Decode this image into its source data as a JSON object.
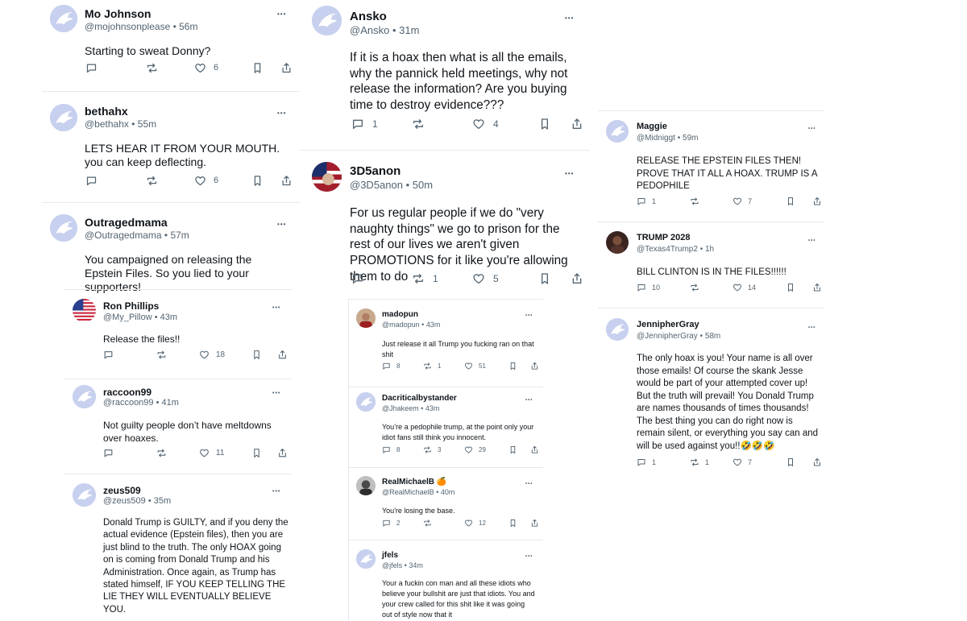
{
  "col1": [
    {
      "name": "Mo Johnson",
      "handle": "@mojohnsonplease",
      "time": "56m",
      "text": "Starting to sweat Donny?",
      "replies": "",
      "reposts": "",
      "likes": "6"
    },
    {
      "name": "bethahx",
      "handle": "@bethahx",
      "time": "55m",
      "text": "LETS HEAR IT FROM YOUR MOUTH.\nyou can keep deflecting.",
      "replies": "",
      "reposts": "",
      "likes": "6"
    },
    {
      "name": "Outragedmama",
      "handle": "@Outragedmama",
      "time": "57m",
      "text": "You campaigned on releasing the Epstein Files. So you lied to your supporters!",
      "replies": "",
      "reposts": "",
      "likes": ""
    },
    {
      "name": "Ron Phillips",
      "handle": "@My_Pillow",
      "time": "43m",
      "text": "Release the files!!",
      "replies": "",
      "reposts": "",
      "likes": "18"
    },
    {
      "name": "raccoon99",
      "handle": "@raccoon99",
      "time": "41m",
      "text": "Not guilty people don’t have meltdowns over hoaxes.",
      "replies": "",
      "reposts": "",
      "likes": "11"
    },
    {
      "name": "zeus509",
      "handle": "@zeus509",
      "time": "35m",
      "text": "Donald Trump is GUILTY, and if you deny the actual evidence (Epstein files), then you are just blind to the truth. The only HOAX going on is coming from Donald Trump and his Administration. Once again, as Trump has stated himself, IF YOU KEEP TELLING THE LIE THEY WILL EVENTUALLY BELIEVE YOU.",
      "replies": "",
      "reposts": "",
      "likes": ""
    }
  ],
  "col2": [
    {
      "name": "Ansko",
      "handle": "@Ansko",
      "time": "31m",
      "text": "If it is a hoax then what is all the emails, why the pannick held meetings, why not release the information? Are you buying time to destroy evidence???",
      "replies": "1",
      "reposts": "",
      "likes": "4"
    },
    {
      "name": "3D5anon",
      "handle": "@3D5anon",
      "time": "50m",
      "text": "For us regular people if we do \"very naughty things\" we go to prison for the rest of our lives we aren't given PROMOTIONS for it like you're allowing them to do",
      "replies": "",
      "reposts": "1",
      "likes": "5"
    },
    {
      "name": "madopun",
      "handle": "@madopun",
      "time": "43m",
      "text": "Just release it all Trump you fucking ran on that shit",
      "replies": "8",
      "reposts": "1",
      "likes": "51"
    },
    {
      "name": "Dacriticalbystander",
      "handle": "@Jhakeem",
      "time": "43m",
      "text": "You’re a pedophile trump, at the point only your idiot fans still think you innocent.",
      "replies": "8",
      "reposts": "3",
      "likes": "29"
    },
    {
      "name": "RealMichaelB 🍊",
      "handle": "@RealMichaelB",
      "time": "40m",
      "text": "You're losing the base.",
      "replies": "2",
      "reposts": "",
      "likes": "12"
    },
    {
      "name": "jfels",
      "handle": "@jfels",
      "time": "34m",
      "text": "Your a fuckin con man and all these idiots who believe your bullshit are just that idiots. You and your crew called for this shit like it was going out of style now that it",
      "replies": "",
      "reposts": "",
      "likes": ""
    }
  ],
  "col3": [
    {
      "name": "Maggie",
      "handle": "@Midniggt",
      "time": "59m",
      "text": "RELEASE THE EPSTEIN FILES THEN! PROVE THAT IT ALL A HOAX. TRUMP IS A PEDOPHILE",
      "replies": "1",
      "reposts": "",
      "likes": "7"
    },
    {
      "name": "TRUMP 2028",
      "handle": "@Texas4Trump2",
      "time": "1h",
      "text": "BILL CLINTON IS IN THE FILES!!!!!!",
      "replies": "10",
      "reposts": "",
      "likes": "14"
    },
    {
      "name": "JennipherGray",
      "handle": "@JennipherGray",
      "time": "58m",
      "text": "The only hoax is you! Your name is all over those emails! Of course the skank Jesse would be part of your attempted cover up! But the truth will prevail! You Donald Trump are names thousands of times thousands! The best thing you can do right now is remain silent, or everything you say can and will be used against you!!🤣🤣🤣",
      "replies": "1",
      "reposts": "1",
      "likes": "7"
    }
  ]
}
